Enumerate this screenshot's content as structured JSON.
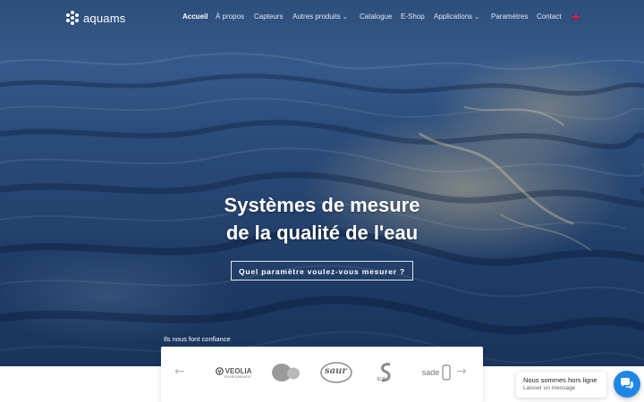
{
  "brand": {
    "name": "aquams"
  },
  "nav": {
    "items": [
      {
        "label": "Accueil",
        "active": true,
        "dropdown": false
      },
      {
        "label": "À propos",
        "active": false,
        "dropdown": false
      },
      {
        "label": "Capteurs",
        "active": false,
        "dropdown": false
      },
      {
        "label": "Autres produits",
        "active": false,
        "dropdown": true
      },
      {
        "label": "Catalogue",
        "active": false,
        "dropdown": false
      },
      {
        "label": "E-Shop",
        "active": false,
        "dropdown": false
      },
      {
        "label": "Applications",
        "active": false,
        "dropdown": true
      },
      {
        "label": "Paramètres",
        "active": false,
        "dropdown": false
      },
      {
        "label": "Contact",
        "active": false,
        "dropdown": false
      }
    ],
    "language_icon": "uk-flag-icon"
  },
  "hero": {
    "title_line1": "Systèmes de mesure",
    "title_line2": "de la qualité de l'eau",
    "cta_label": "Quel paramètre voulez-vous mesurer ?"
  },
  "partners": {
    "label": "Ils nous font confiance",
    "logos": [
      {
        "name": "VEOLIA",
        "sub": "ENVIRONNEMENT"
      },
      {
        "name": "Suez",
        "sub": ""
      },
      {
        "name": "saur",
        "sub": ""
      },
      {
        "name": "SCP",
        "sub": ""
      },
      {
        "name": "sade",
        "sub": ""
      }
    ],
    "prev_icon": "arrow-left-icon",
    "next_icon": "arrow-right-icon"
  },
  "chat": {
    "title": "Nous sommes hors ligne",
    "subtitle": "Laisser un message",
    "icon": "chat-bubbles-icon",
    "color": "#1e87e5"
  },
  "colors": {
    "accent": "#1e87e5",
    "hero_dark": "#1a345c"
  }
}
